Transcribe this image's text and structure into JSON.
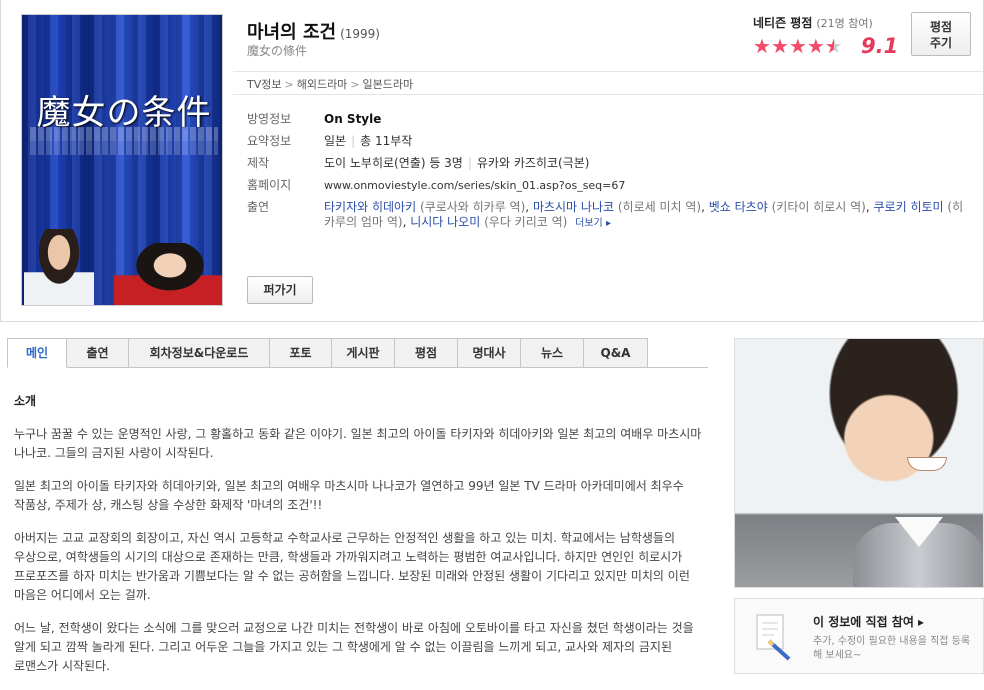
{
  "movie": {
    "title": "마녀의 조건",
    "year": "(1999)",
    "original_title": "魔女の條件",
    "poster_title": "魔女の条件"
  },
  "rating": {
    "label": "네티즌 평점",
    "count": "(21명 참여)",
    "score": "9.1",
    "stars_filled": 4.5,
    "stars_total": 5,
    "button_line1": "평점",
    "button_line2": "주기"
  },
  "breadcrumb": [
    "TV정보",
    "해외드라마",
    "일본드라마"
  ],
  "details": {
    "broadcast_label": "방영정보",
    "broadcast_value": "On Style",
    "summary_label": "요약정보",
    "summary_country": "일본",
    "summary_episodes": "총 11부작",
    "production_label": "제작",
    "production_director": "도이 노부히로(연출) 등 3명",
    "production_writer": "유카와 카즈히코(극본)",
    "homepage_label": "홈페이지",
    "homepage_value": "www.onmoviestyle.com/series/skin_01.asp?os_seq=67",
    "cast_label": "출연",
    "cast": [
      {
        "name": "타키자와 히데아키",
        "role": "(쿠로사와 히카루 역)"
      },
      {
        "name": "마츠시마 나나코",
        "role": "(히로세 미치 역)"
      },
      {
        "name": "벳쇼 타츠야",
        "role": "(키타이 히로시 역)"
      },
      {
        "name": "쿠로키 히토미",
        "role": "(히카루의 엄마 역)"
      },
      {
        "name": "니시다 나오미",
        "role": "(우다 키리코 역)"
      }
    ],
    "more_label": "더보기"
  },
  "share_button": "퍼가기",
  "tabs": [
    "메인",
    "출연",
    "회차정보&다운로드",
    "포토",
    "게시판",
    "평점",
    "명대사",
    "뉴스",
    "Q&A"
  ],
  "active_tab": "메인",
  "content": {
    "heading": "소개",
    "paragraphs": [
      "누구나 꿈꿀 수 있는 운명적인 사랑, 그 황홀하고 동화 같은 이야기. 일본 최고의 아이돌 타키자와 히데아키와 일본 최고의 여배우 마츠시마 나나코. 그들의 금지된 사랑이 시작된다.",
      "일본 최고의 아이돌 타키자와 히데아키와, 일본 최고의 여배우 마츠시마 나나코가 열연하고 99년 일본 TV 드라마 아카데미에서 최우수 작품상, 주제가 상, 캐스팅 상을 수상한 화제작 '마녀의 조건'!!",
      "아버지는 고교 교장회의 회장이고, 자신 역시 고등학교 수학교사로 근무하는 안정적인 생활을 하고 있는 미치. 학교에서는 남학생들의 우상으로, 여학생들의 시기의 대상으로 존재하는 만큼, 학생들과 가까워지려고 노력하는 평범한 여교사입니다. 하지만 연인인 히로시가 프로포즈를 하자 미치는 반가움과 기쁨보다는 알 수 없는 공허함을 느낍니다. 보장된 미래와 안정된 생활이 기다리고 있지만 미치의 이런 마음은 어디에서 오는 걸까.",
      "어느 날, 전학생이 왔다는 소식에 그를 맞으러 교정으로 나간 미치는 전학생이 바로 아침에 오토바이를 타고 자신을 쳤던 학생이라는 것을 알게 되고 깜짝 놀라게 된다. 그리고 어두운 그늘을 가지고 있는 그 학생에게 알 수 없는 이끌림을 느끼게 되고, 교사와 제자의 금지된 로맨스가 시작된다."
    ]
  },
  "participate": {
    "title": "이 정보에 직접 참여",
    "desc": "추가, 수정이 필요한 내용을 직접 등록해 보세요~"
  },
  "colors": {
    "star": "#f04c6a",
    "score": "#e8395b",
    "link": "#2a4ea8",
    "active_tab": "#2b66cc"
  }
}
